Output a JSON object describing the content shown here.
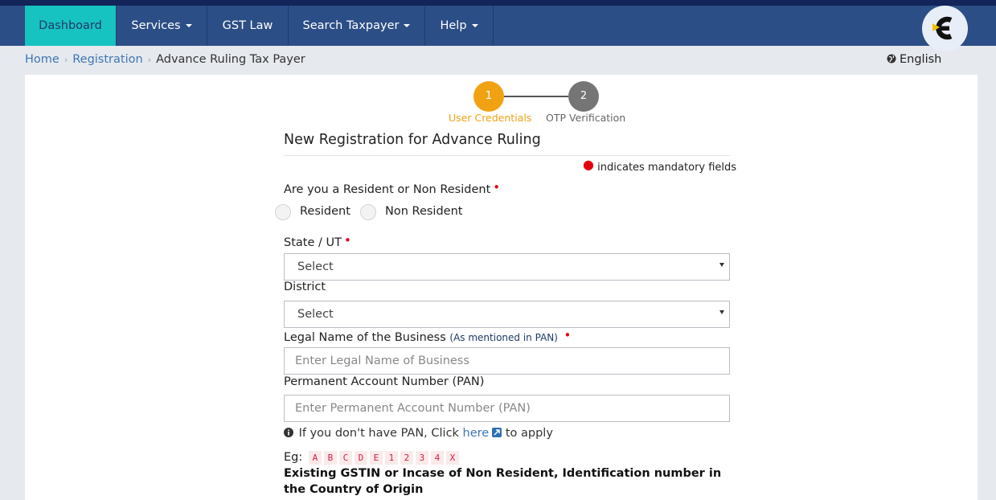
{
  "nav": {
    "items": [
      {
        "label": "Dashboard",
        "active": true,
        "dropdown": false
      },
      {
        "label": "Services",
        "active": false,
        "dropdown": true
      },
      {
        "label": "GST Law",
        "active": false,
        "dropdown": false
      },
      {
        "label": "Search Taxpayer",
        "active": false,
        "dropdown": true
      },
      {
        "label": "Help",
        "active": false,
        "dropdown": true
      }
    ]
  },
  "breadcrumb": {
    "home": "Home",
    "registration": "Registration",
    "current": "Advance Ruling Tax Payer",
    "separator": "›"
  },
  "language": {
    "label": "English",
    "icon": "globe-icon"
  },
  "steps": [
    {
      "number": "1",
      "label": "User Credentials",
      "state": "active"
    },
    {
      "number": "2",
      "label": "OTP Verification",
      "state": "pending"
    }
  ],
  "form": {
    "title": "New Registration for Advance Ruling",
    "mandatory_note": "indicates mandatory fields",
    "resident_question": "Are you a Resident or Non Resident",
    "resident_options": [
      "Resident",
      "Non Resident"
    ],
    "state_label": "State / UT",
    "state_value": "Select",
    "district_label": "District",
    "district_value": "Select",
    "legal_name_label": "Legal Name of the Business",
    "legal_name_hint": "(As mentioned in PAN)",
    "legal_name_placeholder": "Enter Legal Name of Business",
    "pan_label": "Permanent Account Number (PAN)",
    "pan_placeholder": "Enter Permanent Account Number (PAN)",
    "pan_help_prefix": "If you don't have PAN, Click",
    "pan_help_link": "here",
    "pan_help_suffix": "to apply",
    "example_label": "Eg:",
    "example_chars": [
      "A",
      "B",
      "C",
      "D",
      "E",
      "1",
      "2",
      "3",
      "4",
      "X"
    ],
    "gstin_label": "Existing GSTIN or Incase of Non Resident, Identification number in the Country of Origin"
  },
  "colors": {
    "nav_bg": "#2c4e86",
    "nav_active": "#17c3c1",
    "step_active": "#f0a212",
    "step_pending": "#757575",
    "link": "#3c76b5",
    "required": "#e4000d"
  }
}
